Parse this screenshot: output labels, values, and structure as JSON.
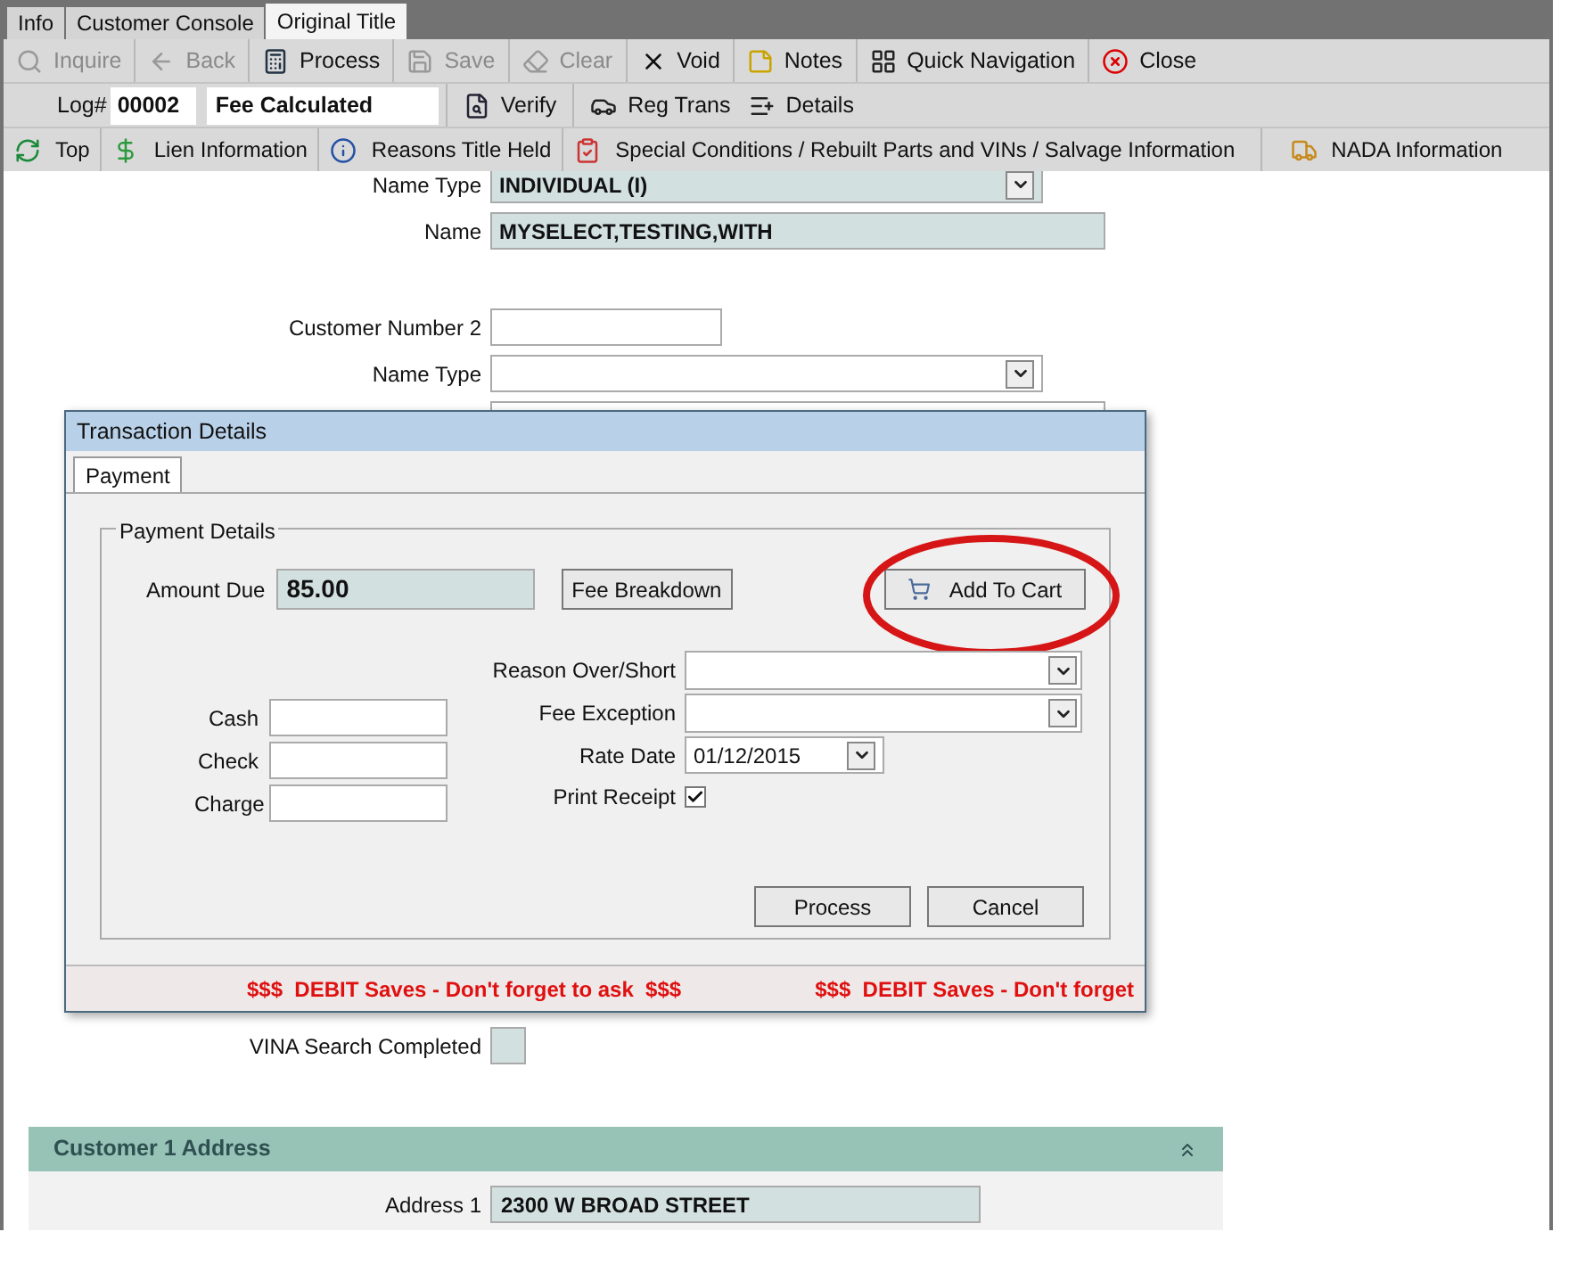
{
  "tabs": [
    {
      "label": "Info",
      "selected": false
    },
    {
      "label": "Customer Console",
      "selected": false
    },
    {
      "label": "Original Title",
      "selected": true
    }
  ],
  "toolbar": [
    {
      "label": "Inquire",
      "disabled": true
    },
    {
      "label": "Back",
      "disabled": true
    },
    {
      "label": "Process",
      "disabled": false
    },
    {
      "label": "Save",
      "disabled": true
    },
    {
      "label": "Clear",
      "disabled": true
    },
    {
      "label": "Void",
      "disabled": false
    },
    {
      "label": "Notes",
      "disabled": false
    },
    {
      "label": "Quick Navigation",
      "disabled": false
    },
    {
      "label": "Close",
      "disabled": false
    }
  ],
  "log": {
    "label": "Log#",
    "number": "00002",
    "status": "Fee Calculated",
    "buttons": [
      {
        "label": "Verify"
      },
      {
        "label": "Reg Trans"
      },
      {
        "label": "Details"
      }
    ]
  },
  "sections_nav": [
    {
      "label": "Top"
    },
    {
      "label": "Lien Information"
    },
    {
      "label": "Reasons Title Held"
    },
    {
      "label": "Special Conditions / Rebuilt Parts and VINs / Salvage Information"
    },
    {
      "label": "NADA Information"
    }
  ],
  "form": [
    {
      "label": "Name Type",
      "kind": "dropdown",
      "value": "INDIVIDUAL (I)",
      "filled": true
    },
    {
      "label": "Name",
      "kind": "text",
      "value": "MYSELECT,TESTING,WITH",
      "filled": true
    },
    {
      "label": "Customer Number 2",
      "kind": "short",
      "filled": false
    },
    {
      "label": "Name Type",
      "kind": "dropdown",
      "filled": false
    },
    {
      "kind": "text",
      "filled": false
    }
  ],
  "dialog": {
    "title": "Transaction Details",
    "tabs": [
      {
        "label": "Payment",
        "selected": true
      }
    ],
    "group": "Payment Details",
    "amount_label": "Amount Due",
    "amount": "85.00",
    "fee_breakdown": "Fee Breakdown",
    "add_to_cart": "Add To Cart",
    "tenders": [
      {
        "label": "Cash"
      },
      {
        "label": "Check"
      },
      {
        "label": "Charge"
      }
    ],
    "reason_label": "Reason Over/Short",
    "fee_exception_label": "Fee Exception",
    "rate_date_label": "Rate Date",
    "rate_date": "01/12/2015",
    "print_receipt_label": "Print Receipt",
    "print_receipt": true,
    "buttons": [
      "Process",
      "Cancel"
    ],
    "messages": [
      "$$$  DEBIT Saves - Don't forget to ask  $$$",
      "$$$  DEBIT Saves - Don't forget"
    ]
  },
  "vina": {
    "label": "VINA Search Completed",
    "checked": false
  },
  "address_section": {
    "title": "Customer 1 Address",
    "expanded": true,
    "fields": [
      {
        "label": "Address 1",
        "value": "2300 W BROAD STREET"
      }
    ]
  }
}
